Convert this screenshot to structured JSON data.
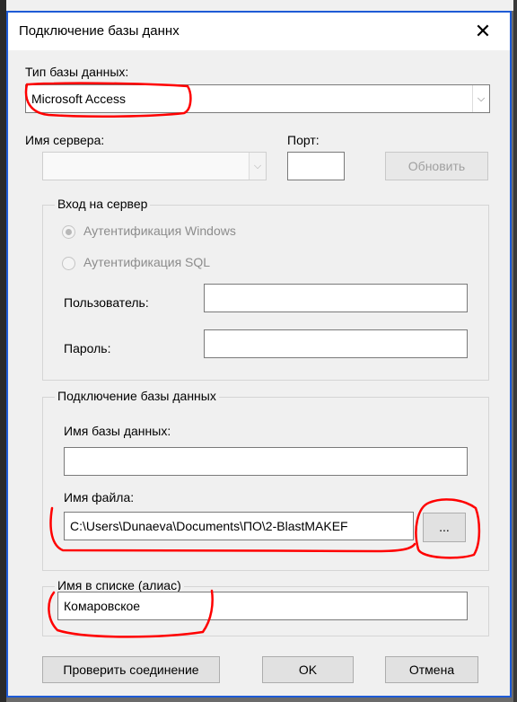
{
  "dialog": {
    "title": "Подключение базы даннх",
    "close_glyph": "✕"
  },
  "db_type": {
    "label": "Тип базы данных:",
    "value": "Microsoft Access"
  },
  "server": {
    "label": "Имя сервера:",
    "value": "",
    "port_label": "Порт:",
    "port_value": "",
    "refresh_label": "Обновить"
  },
  "login_group": {
    "title": "Вход на сервер",
    "auth_windows": "Аутентификация Windows",
    "auth_sql": "Аутентификация SQL",
    "user_label": "Пользователь:",
    "user_value": "",
    "password_label": "Пароль:",
    "password_value": ""
  },
  "db_group": {
    "title": "Подключение базы данных",
    "db_name_label": "Имя базы данных:",
    "db_name_value": "",
    "file_label": "Имя файла:",
    "file_value": "C:\\Users\\Dunaeva\\Documents\\ПО\\2-BlastMAKEF",
    "browse_label": "..."
  },
  "alias_group": {
    "title": "Имя в списке (алиас)",
    "value": "Комаровское"
  },
  "buttons": {
    "check": "Проверить соединение",
    "ok": "OK",
    "cancel": "Отмена"
  },
  "colors": {
    "annotation": "#ff0000",
    "window_border": "#1e5bd6"
  }
}
